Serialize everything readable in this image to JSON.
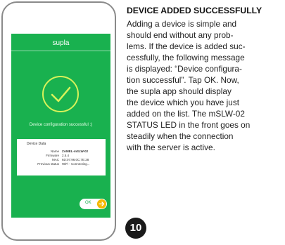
{
  "phone": {
    "app_title": "supla",
    "success_message": "Device configuration successful :)",
    "device_data": {
      "title": "Device Data",
      "rows": [
        {
          "label": "Name",
          "value": "ZAMEL-mSLW-02",
          "bold": true
        },
        {
          "label": "Firmware",
          "value": "2.5.4"
        },
        {
          "label": "MAC",
          "value": "6D:07:96:0C:7E:28"
        },
        {
          "label": "Previous status",
          "value": "WiFi - Connecting..."
        }
      ]
    },
    "ok_label": "OK",
    "colors": {
      "screen": "#19b14f",
      "ok_arrow": "#f5b800"
    }
  },
  "instructions": {
    "heading": "DEVICE ADDED SUCCESSFULLY",
    "lines": [
      "Adding a device is simple and",
      "should end without any prob-",
      "lems. If the device is added suc-",
      "cessfully, the following message",
      "is displayed: “Device configura-",
      "tion successful”. Tap OK. Now,",
      "the supla app should display",
      "the device which you have just",
      "added on the list. The mSLW-02",
      "STATUS LED in the front goes on",
      "steadily when the connection",
      "with the server is active."
    ],
    "step_number": "10"
  }
}
